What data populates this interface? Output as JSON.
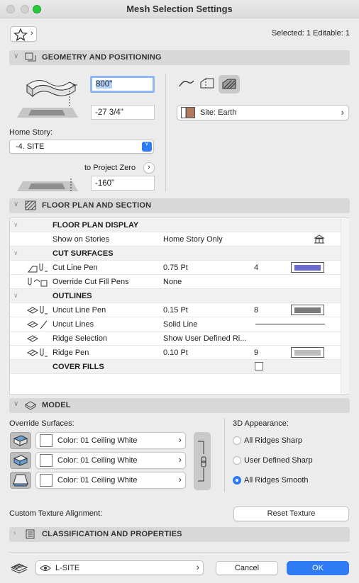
{
  "window": {
    "title": "Mesh Selection Settings"
  },
  "header": {
    "selected_status": "Selected: 1 Editable: 1"
  },
  "geometry": {
    "section_title": "GEOMETRY AND POSITIONING",
    "thickness_value": "800\"",
    "offset_value": "-27 3/4\"",
    "home_story_label": "Home Story:",
    "home_story_value": "-4. SITE",
    "to_project_zero_label": "to Project Zero",
    "project_zero_value": "-160\"",
    "surface_label": "Site: Earth"
  },
  "floor_plan": {
    "section_title": "FLOOR PLAN AND SECTION",
    "rows": [
      {
        "label": "FLOOR PLAN DISPLAY",
        "header": true
      },
      {
        "label": "Show on Stories",
        "value": "Home Story Only"
      },
      {
        "label": "CUT SURFACES",
        "header": true
      },
      {
        "label": "Cut Line Pen",
        "value": "0.75 Pt",
        "pen": "4",
        "pen_color": "#6a6ad0"
      },
      {
        "label": "Override Cut Fill Pens",
        "value": "None"
      },
      {
        "label": "OUTLINES",
        "header": true
      },
      {
        "label": "Uncut Line Pen",
        "value": "0.15 Pt",
        "pen": "8",
        "pen_color": "#7a7a7a"
      },
      {
        "label": "Uncut Lines",
        "value": "Solid Line"
      },
      {
        "label": "Ridge Selection",
        "value": "Show User Defined Ri..."
      },
      {
        "label": "Ridge Pen",
        "value": "0.10 Pt",
        "pen": "9",
        "pen_color": "#bdbdbd"
      },
      {
        "label": "COVER FILLS",
        "header": true
      }
    ]
  },
  "model": {
    "section_title": "MODEL",
    "override_surfaces_label": "Override Surfaces:",
    "surfaces": [
      {
        "label": "Color: 01 Ceiling White"
      },
      {
        "label": "Color: 01 Ceiling White"
      },
      {
        "label": "Color: 01 Ceiling White"
      }
    ],
    "appearance_label": "3D Appearance:",
    "appearance_options": [
      {
        "label": "All Ridges Sharp",
        "selected": false
      },
      {
        "label": "User Defined Sharp",
        "selected": false
      },
      {
        "label": "All Ridges Smooth",
        "selected": true
      }
    ],
    "custom_texture_label": "Custom Texture Alignment:",
    "reset_texture_label": "Reset Texture"
  },
  "classification": {
    "section_title": "CLASSIFICATION AND PROPERTIES"
  },
  "footer": {
    "layer_value": "L-SITE",
    "cancel_label": "Cancel",
    "ok_label": "OK"
  },
  "colors": {
    "accent": "#2f7bf5",
    "close": "#fe5f57",
    "minimize": "#febc2e",
    "zoom": "#28c840"
  }
}
